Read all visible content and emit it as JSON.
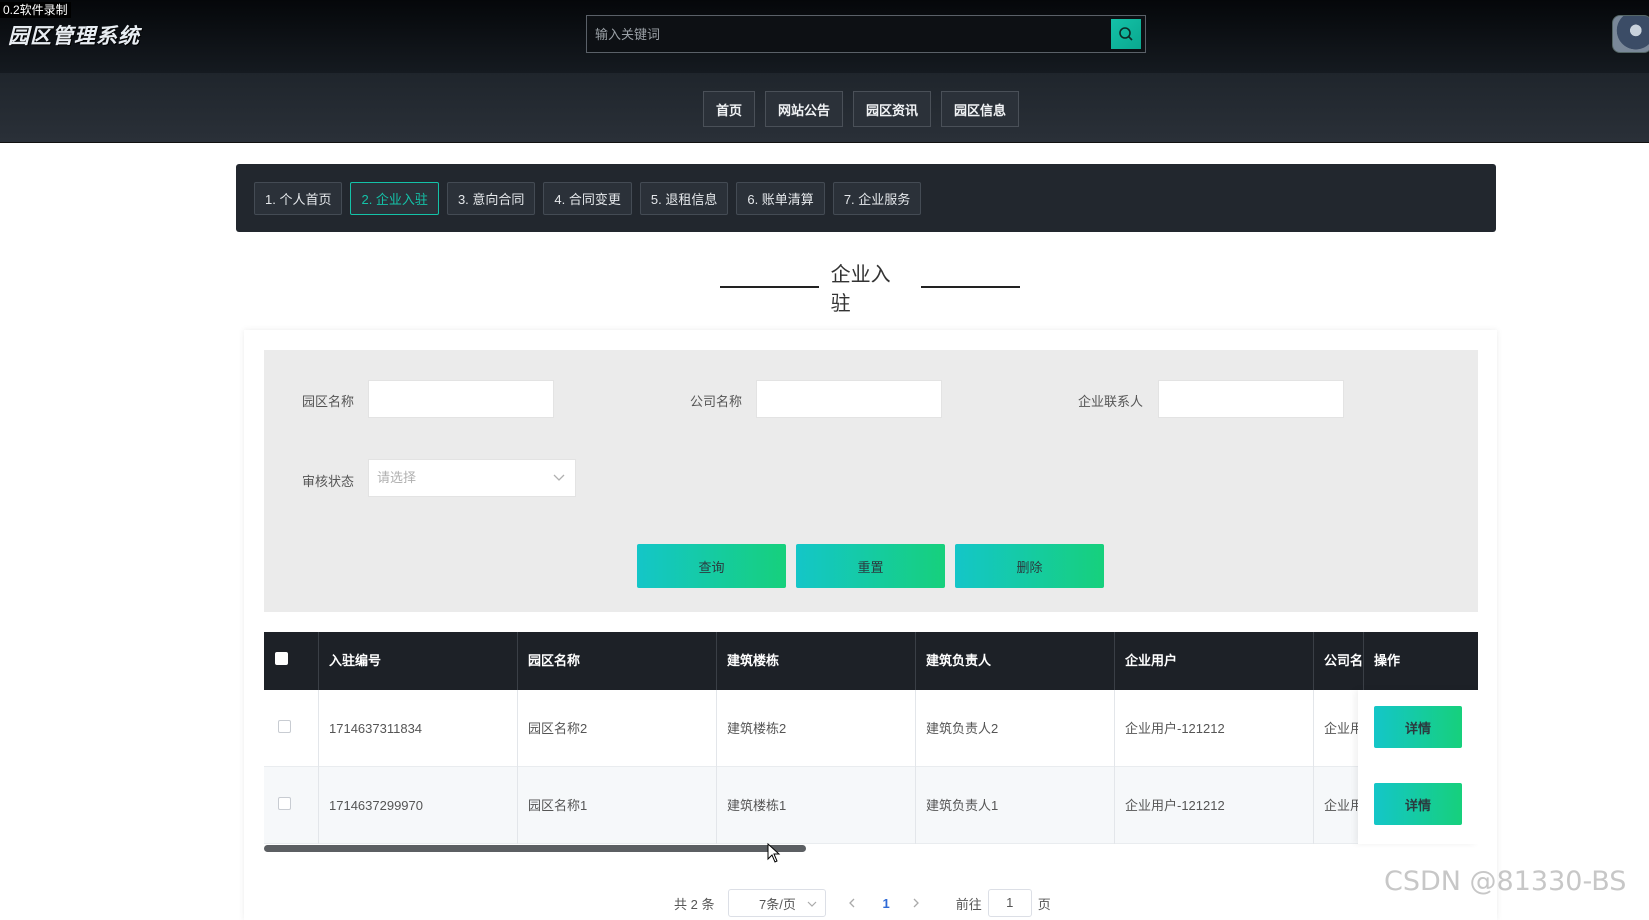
{
  "recorder_label": "0.2软件录制",
  "app": {
    "logo": "园区管理系统"
  },
  "search": {
    "placeholder": "输入关键词"
  },
  "nav": {
    "items": [
      {
        "label": "首页"
      },
      {
        "label": "网站公告"
      },
      {
        "label": "园区资讯"
      },
      {
        "label": "园区信息"
      }
    ]
  },
  "steps": {
    "items": [
      {
        "label": "1. 个人首页"
      },
      {
        "label": "2. 企业入驻"
      },
      {
        "label": "3. 意向合同"
      },
      {
        "label": "4. 合同变更"
      },
      {
        "label": "5. 退租信息"
      },
      {
        "label": "6. 账单清算"
      },
      {
        "label": "7. 企业服务"
      }
    ],
    "active_index": 1
  },
  "section": {
    "title": "企业入驻"
  },
  "filters": {
    "park_name_label": "园区名称",
    "company_name_label": "公司名称",
    "contact_label": "企业联系人",
    "status_label": "审核状态",
    "status_placeholder": "请选择",
    "query_button": "查询",
    "reset_button": "重置",
    "delete_button": "删除"
  },
  "table": {
    "headers": {
      "entry_no": "入驻编号",
      "park_name": "园区名称",
      "building": "建筑楼栋",
      "building_manager": "建筑负责人",
      "enterprise_user": "企业用户",
      "company": "公司名",
      "operation": "操作"
    },
    "rows": [
      {
        "entry_no": "1714637311834",
        "park_name": "园区名称2",
        "building": "建筑楼栋2",
        "building_manager": "建筑负责人2",
        "enterprise_user": "企业用户-121212",
        "company": "企业用",
        "action": "详情"
      },
      {
        "entry_no": "1714637299970",
        "park_name": "园区名称1",
        "building": "建筑楼栋1",
        "building_manager": "建筑负责人1",
        "enterprise_user": "企业用户-121212",
        "company": "企业用",
        "action": "详情"
      }
    ]
  },
  "pagination": {
    "total_text": "共 2 条",
    "page_size": "7条/页",
    "current_page": "1",
    "goto_label": "前往",
    "goto_value": "1",
    "page_unit": "页"
  },
  "watermark": "CSDN @81330-BS",
  "colors": {
    "accent": "#14c2a8",
    "header_dark": "#1d2127",
    "gradient_start": "#14c6c8",
    "gradient_end": "#16d07c"
  }
}
